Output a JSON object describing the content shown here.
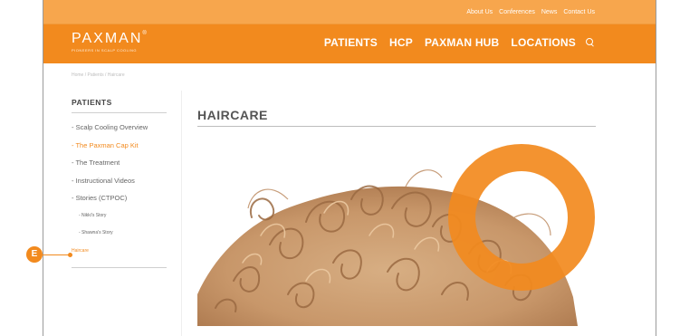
{
  "topbar": {
    "links": [
      "About Us",
      "Conferences",
      "News",
      "Contact Us"
    ]
  },
  "header": {
    "logo": "PAXMAN",
    "logo_mark": "®",
    "tagline": "PIONEERS IN SCALP COOLING",
    "nav": [
      "PATIENTS",
      "HCP",
      "PAXMAN HUB",
      "LOCATIONS"
    ]
  },
  "breadcrumb": "Home / Patients / Haircare",
  "sidebar": {
    "title": "PATIENTS",
    "items": [
      "- Scalp Cooling Overview",
      "- The Paxman Cap Kit",
      "- The Treatment",
      "- Instructional Videos",
      "- Stories (CTPOC)",
      "- Nikki's Story",
      "- Shawna's Story",
      "Haircare"
    ]
  },
  "main": {
    "title": "HAIRCARE"
  },
  "callout": {
    "label": "E"
  },
  "colors": {
    "brand_orange": "#f28a1e",
    "topbar_orange": "#f7a64d",
    "hair": "#c99a6b"
  }
}
